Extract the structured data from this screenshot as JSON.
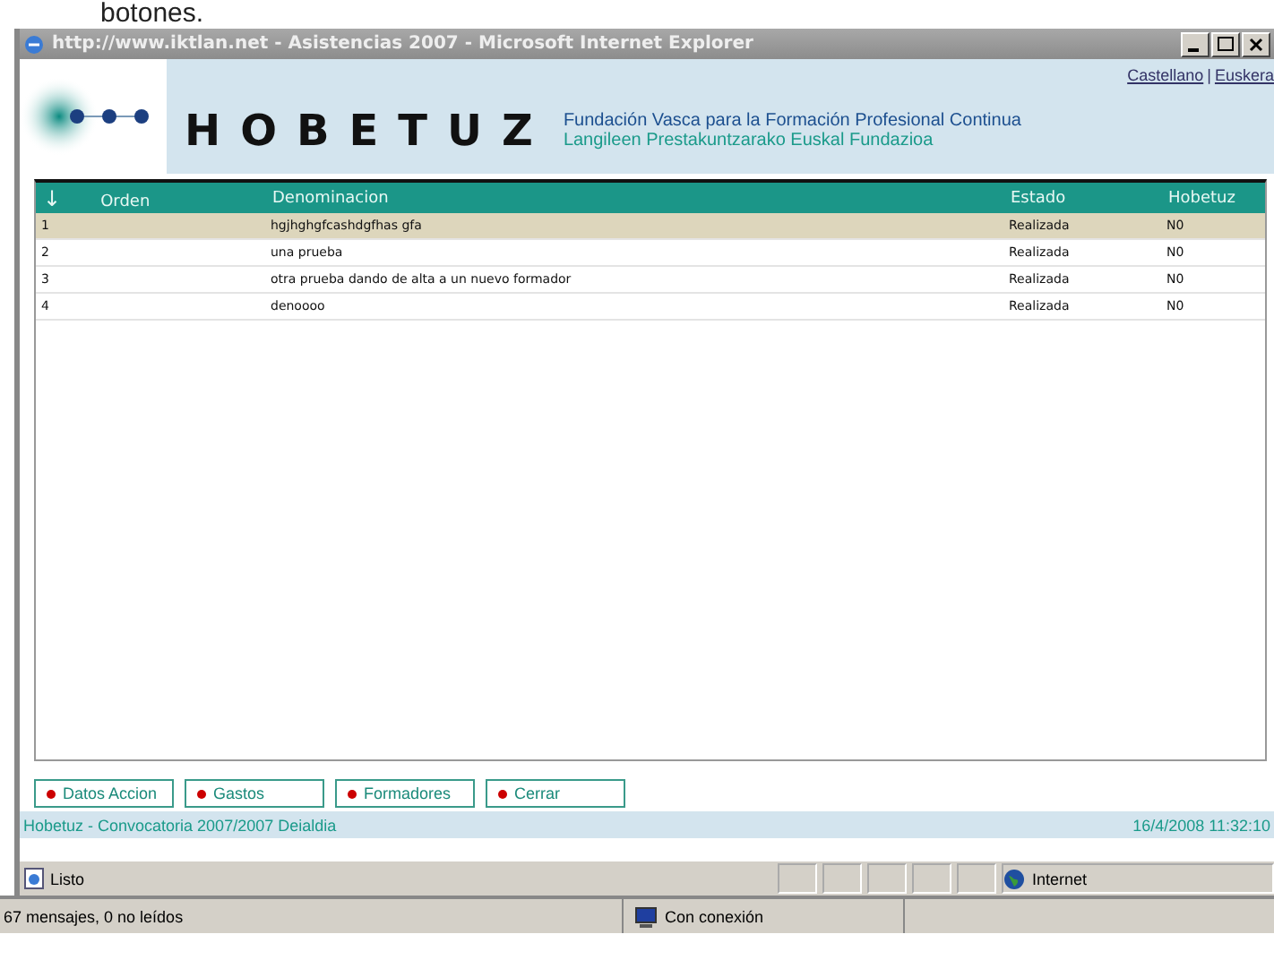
{
  "background_text": "botones.",
  "window": {
    "title": "http://www.iktlan.net - Asistencias 2007 - Microsoft Internet Explorer"
  },
  "header": {
    "languages": [
      "Castellano",
      "Euskera"
    ],
    "language_separator": "|",
    "brand": "HOBETUZ",
    "subtitle_1": "Fundación Vasca para la Formación Profesional Continua",
    "subtitle_2": "Langileen Prestakuntzarako Euskal Fundazioa"
  },
  "table": {
    "sort_glyph": "↓",
    "columns": [
      "Orden",
      "Denominacion",
      "Estado",
      "Hobetuz"
    ],
    "rows": [
      {
        "orden": "1",
        "denominacion": "hgjhghgfcashdgfhas gfa",
        "estado": "Realizada",
        "hobetuz": "N0",
        "selected": true
      },
      {
        "orden": "2",
        "denominacion": "una prueba",
        "estado": "Realizada",
        "hobetuz": "N0",
        "selected": false
      },
      {
        "orden": "3",
        "denominacion": "otra prueba dando de alta a un nuevo formador",
        "estado": "Realizada",
        "hobetuz": "N0",
        "selected": false
      },
      {
        "orden": "4",
        "denominacion": "denoooo",
        "estado": "Realizada",
        "hobetuz": "N0",
        "selected": false
      }
    ]
  },
  "buttons": [
    "Datos Accion",
    "Gastos",
    "Formadores",
    "Cerrar"
  ],
  "footer": {
    "left": "Hobetuz - Convocatoria 2007/2007 Deialdia",
    "right": "16/4/2008 11:32:10"
  },
  "status_bar": {
    "text": "Listo",
    "zone": "Internet"
  },
  "mail_status": {
    "messages": "67 mensajes, 0 no leídos",
    "connection": "Con conexión"
  }
}
